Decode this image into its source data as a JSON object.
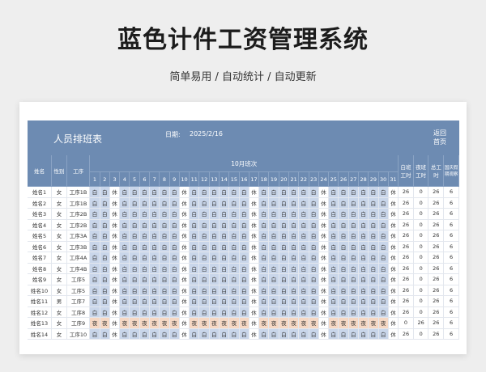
{
  "hero": {
    "title": "蓝色计件工资管理系统",
    "subtitle": "简单易用 / 自动统计 / 自动更新"
  },
  "sheet": {
    "title": "人员排班表",
    "date_label": "日期:",
    "date": "2025/2/16",
    "back_button": "返回首页",
    "columns": {
      "name": "姓名",
      "gender": "性别",
      "process": "工序",
      "month": "10月班次",
      "day_hours": "白班工时",
      "night_hours": "夜班工时",
      "total_hours": "总工时",
      "holiday": "国庆假期观察"
    },
    "days": [
      "1",
      "2",
      "3",
      "4",
      "5",
      "6",
      "7",
      "8",
      "9",
      "10",
      "11",
      "12",
      "13",
      "14",
      "15",
      "16",
      "17",
      "18",
      "19",
      "20",
      "21",
      "22",
      "23",
      "24",
      "25",
      "26",
      "27",
      "28",
      "29",
      "30",
      "31"
    ],
    "rows": [
      {
        "name": "姓名1",
        "gender": "女",
        "process": "工序1B",
        "pattern": "day",
        "day_hours": "26",
        "night_hours": "0",
        "total_hours": "26",
        "holiday": "6"
      },
      {
        "name": "姓名2",
        "gender": "女",
        "process": "工序1B",
        "pattern": "day",
        "day_hours": "26",
        "night_hours": "0",
        "total_hours": "26",
        "holiday": "6"
      },
      {
        "name": "姓名3",
        "gender": "女",
        "process": "工序2B",
        "pattern": "day",
        "day_hours": "26",
        "night_hours": "0",
        "total_hours": "26",
        "holiday": "6"
      },
      {
        "name": "姓名4",
        "gender": "女",
        "process": "工序2B",
        "pattern": "day",
        "day_hours": "26",
        "night_hours": "0",
        "total_hours": "26",
        "holiday": "6"
      },
      {
        "name": "姓名5",
        "gender": "女",
        "process": "工序3A",
        "pattern": "day",
        "day_hours": "26",
        "night_hours": "0",
        "total_hours": "26",
        "holiday": "6"
      },
      {
        "name": "姓名6",
        "gender": "女",
        "process": "工序3B",
        "pattern": "day",
        "day_hours": "26",
        "night_hours": "0",
        "total_hours": "26",
        "holiday": "6"
      },
      {
        "name": "姓名7",
        "gender": "女",
        "process": "工序4A",
        "pattern": "day",
        "day_hours": "26",
        "night_hours": "0",
        "total_hours": "26",
        "holiday": "6"
      },
      {
        "name": "姓名8",
        "gender": "女",
        "process": "工序4B",
        "pattern": "day",
        "day_hours": "26",
        "night_hours": "0",
        "total_hours": "26",
        "holiday": "6"
      },
      {
        "name": "姓名9",
        "gender": "女",
        "process": "工序5",
        "pattern": "day",
        "day_hours": "26",
        "night_hours": "0",
        "total_hours": "26",
        "holiday": "6"
      },
      {
        "name": "姓名10",
        "gender": "女",
        "process": "工序5",
        "pattern": "day",
        "day_hours": "26",
        "night_hours": "0",
        "total_hours": "26",
        "holiday": "6"
      },
      {
        "name": "姓名11",
        "gender": "男",
        "process": "工序7",
        "pattern": "day",
        "day_hours": "26",
        "night_hours": "0",
        "total_hours": "26",
        "holiday": "6"
      },
      {
        "name": "姓名12",
        "gender": "女",
        "process": "工序8",
        "pattern": "day",
        "day_hours": "26",
        "night_hours": "0",
        "total_hours": "26",
        "holiday": "6"
      },
      {
        "name": "姓名13",
        "gender": "女",
        "process": "工序9",
        "pattern": "night",
        "day_hours": "0",
        "night_hours": "26",
        "total_hours": "26",
        "holiday": "6"
      },
      {
        "name": "姓名14",
        "gender": "女",
        "process": "工序10",
        "pattern": "day",
        "day_hours": "26",
        "night_hours": "0",
        "total_hours": "26",
        "holiday": "6"
      }
    ],
    "shift_labels": {
      "day": "白",
      "night": "夜",
      "rest": "休"
    },
    "rest_days": [
      3,
      10,
      17,
      24,
      31
    ]
  },
  "colors": {
    "header_blue": "#6d8bb2",
    "day_cell": "#c9d6ea",
    "night_cell": "#f6d8c4"
  }
}
